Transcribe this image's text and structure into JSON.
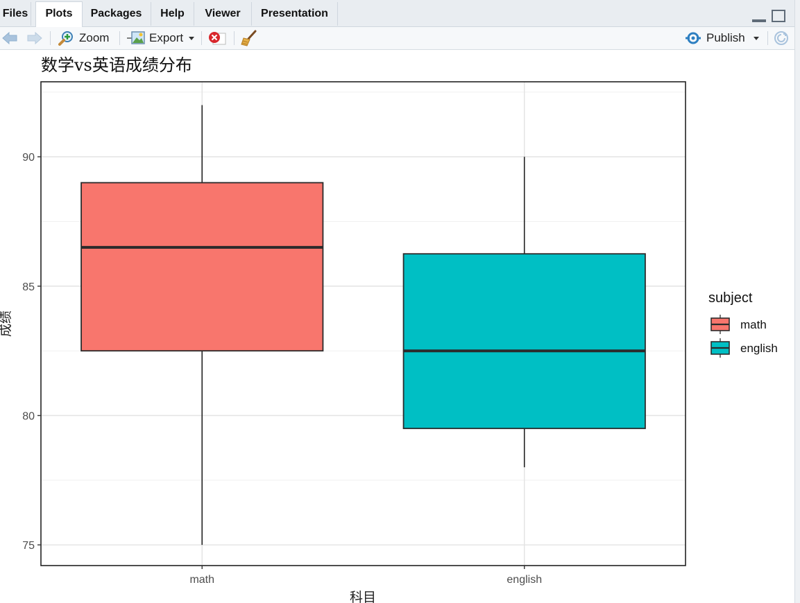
{
  "tabs": [
    {
      "label": "Files",
      "active": false
    },
    {
      "label": "Plots",
      "active": true
    },
    {
      "label": "Packages",
      "active": false
    },
    {
      "label": "Help",
      "active": false
    },
    {
      "label": "Viewer",
      "active": false
    },
    {
      "label": "Presentation",
      "active": false
    }
  ],
  "toolbar": {
    "zoom_label": "Zoom",
    "export_label": "Export",
    "publish_label": "Publish"
  },
  "colors": {
    "math": "#F8766D",
    "english": "#00BFC4"
  },
  "chart_data": {
    "type": "boxplot",
    "title": "数学vs英语成绩分布",
    "xlabel": "科目",
    "ylabel": "成绩",
    "categories": [
      "math",
      "english"
    ],
    "boxes": [
      {
        "name": "math",
        "min": 75,
        "q1": 82.5,
        "median": 86.5,
        "q3": 89,
        "max": 92
      },
      {
        "name": "english",
        "min": 78,
        "q1": 79.5,
        "median": 82.5,
        "q3": 86.25,
        "max": 90
      }
    ],
    "ylim": [
      74.2,
      92.9
    ],
    "yticks": [
      75,
      80,
      85,
      90
    ],
    "grid": true,
    "legend": {
      "title": "subject",
      "entries": [
        "math",
        "english"
      ],
      "position": "right"
    }
  }
}
